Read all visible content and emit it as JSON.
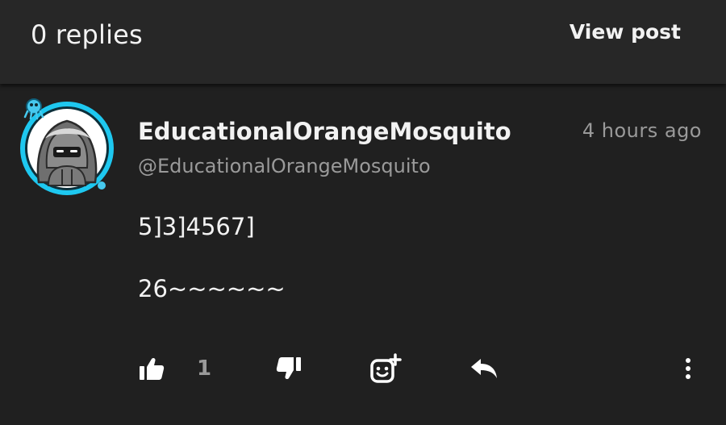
{
  "header": {
    "title": "0 replies",
    "view_post_label": "View post"
  },
  "comment": {
    "username": "EducationalOrangeMosquito",
    "handle": "@EducationalOrangeMosquito",
    "time": "4 hours ago",
    "lines": [
      "5]3]4567]",
      "26~~~~~~"
    ],
    "like_count": "1"
  },
  "icons": {
    "like": "thumbs-up-icon",
    "dislike": "thumbs-down-icon",
    "react": "add-reaction-icon",
    "reply": "reply-icon",
    "more": "more-vertical-icon"
  },
  "colors": {
    "background": "#202020",
    "header": "#272727",
    "text": "#f2f2f2",
    "muted": "#9a9a9a",
    "avatar_ring": "#1ec8f0"
  }
}
